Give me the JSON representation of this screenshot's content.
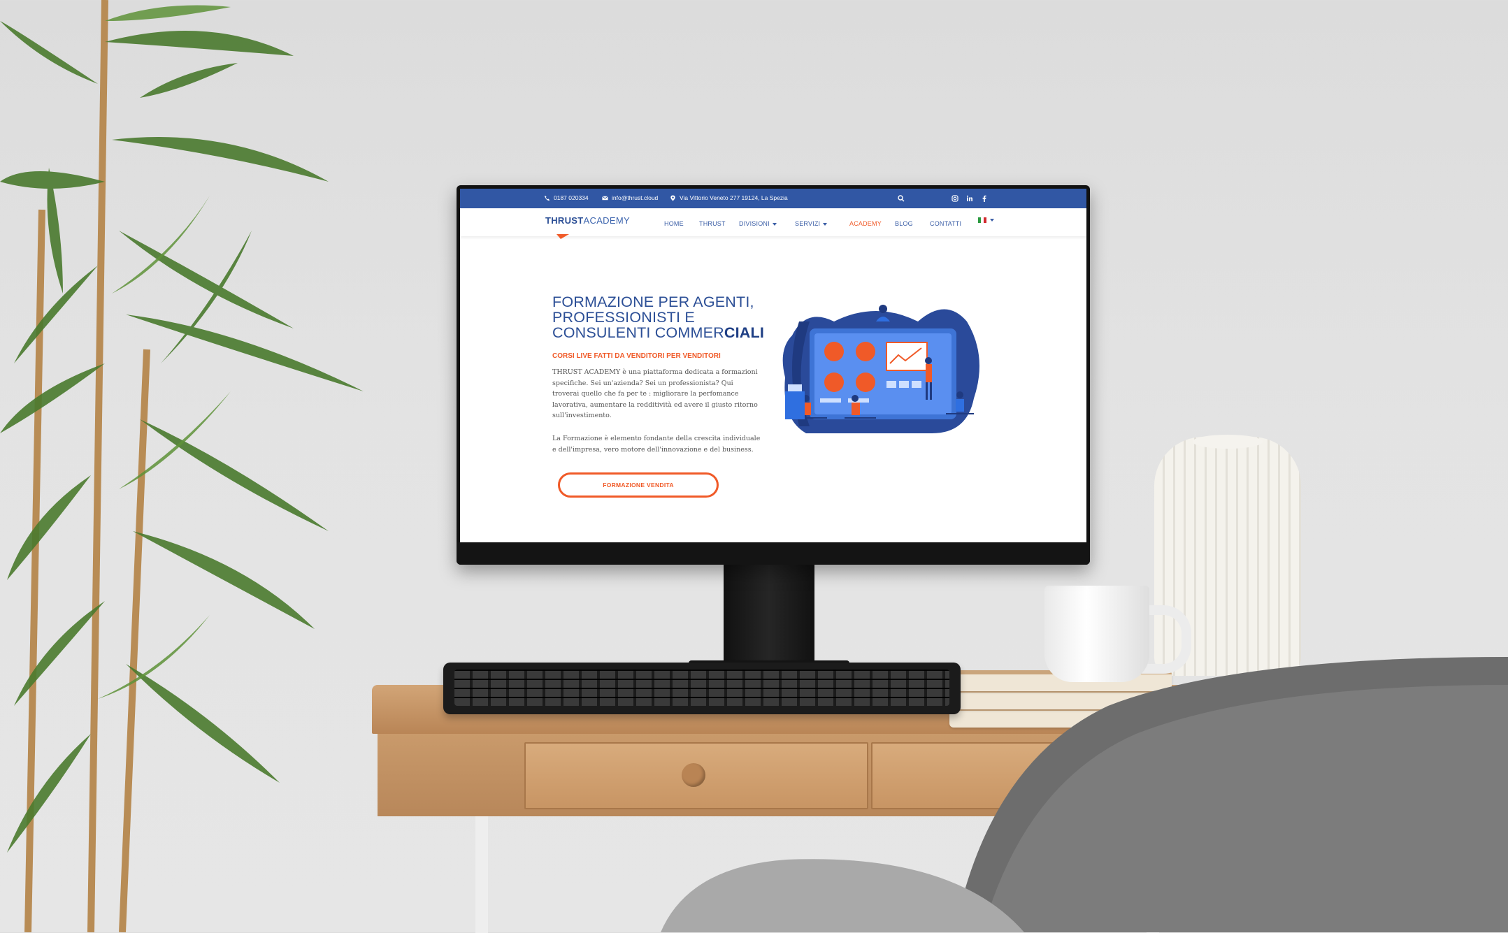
{
  "topbar": {
    "phone": "0187 020334",
    "email": "info@thrust.cloud",
    "address": "Via Vittorio Veneto 277 19124, La Spezia"
  },
  "logo": {
    "part1": "THRUST",
    "part2": "ACADEMY"
  },
  "nav": {
    "items": [
      "HOME",
      "THRUST",
      "DIVISIONI",
      "SERVIZI",
      "ACADEMY",
      "BLOG",
      "CONTATTI"
    ],
    "active": "ACADEMY"
  },
  "hero": {
    "title_line1": "FORMAZIONE PER AGENTI,",
    "title_line2": "PROFESSIONISTI E",
    "title_line3_a": "CONSULENTI COMMER",
    "title_line3_b": "CIALI",
    "subtitle": "CORSI LIVE FATTI DA VENDITORI PER VENDITORI",
    "paragraph1": "THRUST ACADEMY è una piattaforma dedicata a formazioni specifiche. Sei un'azienda? Sei un professionista? Qui troverai quello che fa per te : migliorare la perfomance lavorativa, aumentare la redditività ed avere il giusto ritorno sull'investimento.",
    "paragraph2": "La Formazione è elemento fondante della crescita individuale e dell'impresa, vero motore dell'innovazione e del business.",
    "cta": "FORMAZIONE VENDITA"
  },
  "colors": {
    "brand_blue": "#3157a4",
    "accent_orange": "#f05a28"
  },
  "icons": [
    "phone-icon",
    "mail-icon",
    "location-icon",
    "search-icon",
    "instagram-icon",
    "linkedin-icon",
    "facebook-icon",
    "italian-flag-icon"
  ]
}
